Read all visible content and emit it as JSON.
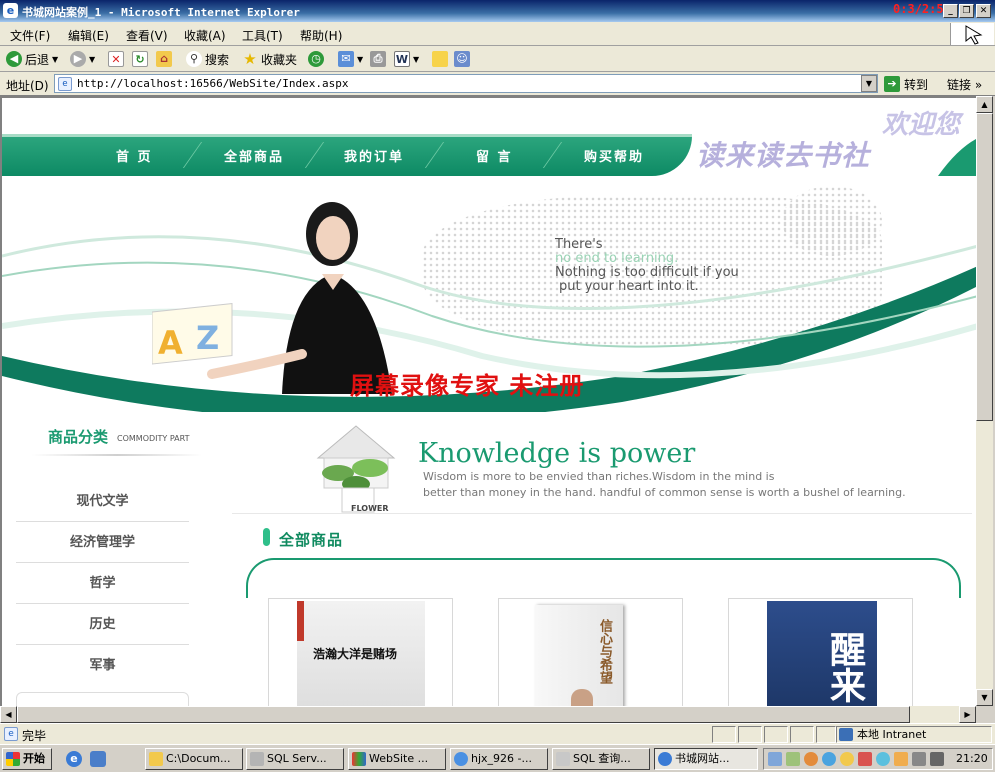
{
  "window": {
    "title": "书城网站案例_1 - Microsoft Internet Explorer",
    "rec_time": "0:3/2:50"
  },
  "menu": [
    "文件(F)",
    "编辑(E)",
    "查看(V)",
    "收藏(A)",
    "工具(T)",
    "帮助(H)"
  ],
  "toolbar": {
    "back": "后退",
    "search": "搜索",
    "favorites": "收藏夹"
  },
  "address": {
    "label": "地址(D)",
    "url": "http://localhost:16566/WebSite/Index.aspx",
    "go": "转到",
    "links": "链接"
  },
  "site": {
    "welcome": "欢迎您",
    "brand": "读来读去书社",
    "nav": [
      "首 页",
      "全部商品",
      "我的订单",
      "留 言",
      "购买帮助"
    ],
    "banner": {
      "line1": "There's",
      "line2": "no end to learning.",
      "line3": "Nothing is too difficult if you",
      "line4": "put your heart into it."
    },
    "watermark": "屏幕录像专家 未注册",
    "category": {
      "title": "商品分类",
      "subtitle": "COMMODITY PART",
      "items": [
        "现代文学",
        "经济管理学",
        "哲学",
        "历史",
        "军事"
      ]
    },
    "knowledge": {
      "title": "Knowledge is power",
      "line1": "Wisdom is more to be envied than riches.Wisdom in the mind is",
      "line2": "better than money in the hand. handful of common sense is worth a bushel of learning.",
      "flower_label": "FLOWER"
    },
    "section_title": "全部商品",
    "books": [
      {
        "cover_text": "浩瀚大洋是赌场"
      },
      {
        "cover_text": "信心与希望"
      },
      {
        "cover_text": "醒来"
      }
    ]
  },
  "status": {
    "text": "完毕",
    "zone": "本地 Intranet"
  },
  "taskbar": {
    "start": "开始",
    "tasks": [
      "C:\\Docum...",
      "SQL Serv...",
      "WebSite ...",
      "hjx_926 -...",
      "SQL 查询...",
      "书城网站..."
    ],
    "clock": "21:20"
  }
}
